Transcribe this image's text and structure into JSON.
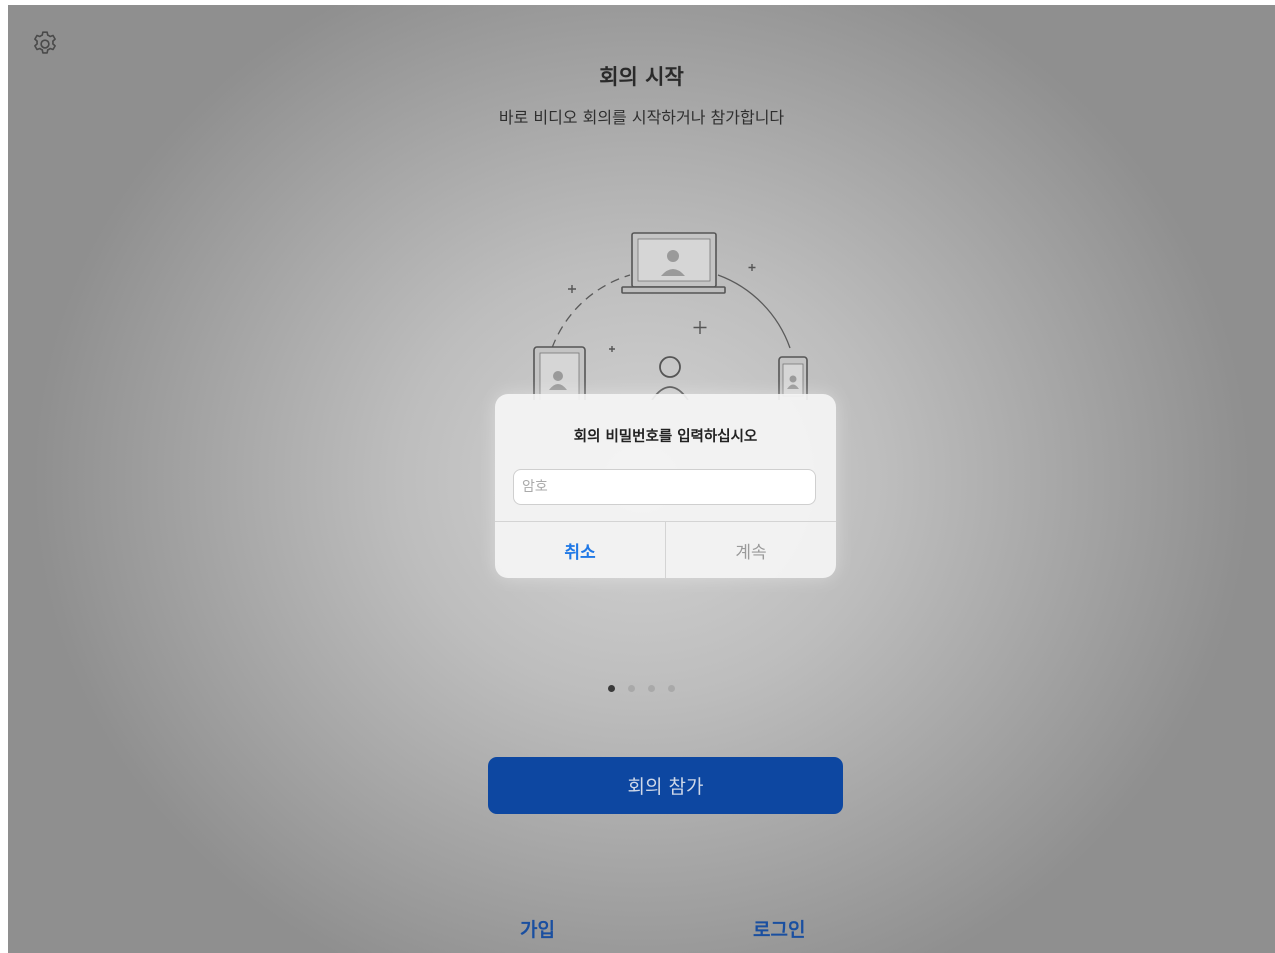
{
  "header": {
    "title": "회의 시작",
    "subtitle": "바로 비디오 회의를 시작하거나 참가합니다"
  },
  "settings": {
    "icon": "gear-icon"
  },
  "illustration": {
    "icons": [
      "laptop-icon",
      "tablet-icon",
      "phone-icon",
      "person-icon"
    ]
  },
  "pager": {
    "count": 4,
    "active_index": 0
  },
  "dialog": {
    "title": "회의 비밀번호를 입력하십시오",
    "password_placeholder": "암호",
    "password_value": "",
    "cancel_label": "취소",
    "continue_label": "계속"
  },
  "actions": {
    "join_label": "회의 참가",
    "signup_label": "가입",
    "login_label": "로그인"
  },
  "colors": {
    "primary": "#0d47a1",
    "link": "#1a4fa0",
    "alert_action": "#1f78e6"
  }
}
